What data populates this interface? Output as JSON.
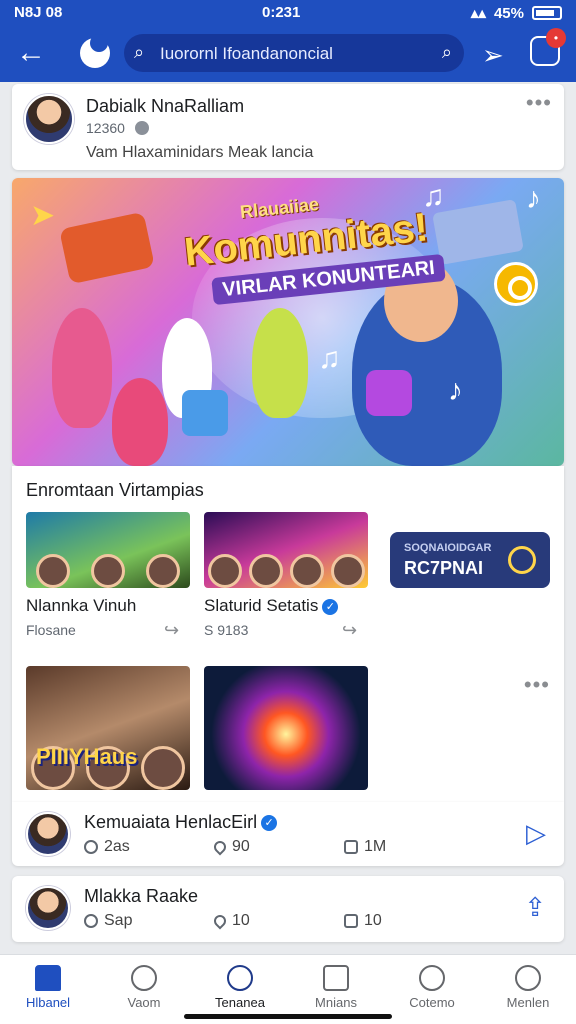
{
  "status_bar": {
    "carrier": "N8J 08",
    "time": "0:231",
    "battery": "45%"
  },
  "header": {
    "search_text": "Iuorornl Ifoandanoncial",
    "badge": "•"
  },
  "post1": {
    "author": "Dabialk NnaRalliam",
    "meta": "12360",
    "subtitle": "Vam Hlaxaminidars Meak lancia"
  },
  "banner": {
    "kicker": "Rlauaiiae",
    "title": "Komunnitas!",
    "subtitle": "VIRLAR KONUNTEARI"
  },
  "feed": {
    "section_title": "Enromtaan Virtampias",
    "items": [
      {
        "title": "Nlannka Vinuh",
        "meta": "Flosane"
      },
      {
        "title": "Slaturid Setatis",
        "meta": "S 9183"
      }
    ],
    "promo": {
      "line1": "SOQNAIOIDGAR",
      "line2": "RC7PNAI"
    },
    "overlay": "PIIIYHaus"
  },
  "post2": {
    "author": "Kemuaiata HenlacEirl",
    "stats": [
      "2as",
      "90",
      "1M"
    ]
  },
  "post3": {
    "author": "Mlakka Raake",
    "stats": [
      "Sap",
      "10",
      "10"
    ]
  },
  "nav": {
    "tabs": [
      "Hlbanel",
      "Vaom",
      "Tenanea",
      "Mnians",
      "Cotemo",
      "Menlen"
    ]
  },
  "colors": {
    "brand": "#1f4fbf",
    "accent": "#f6b800"
  }
}
